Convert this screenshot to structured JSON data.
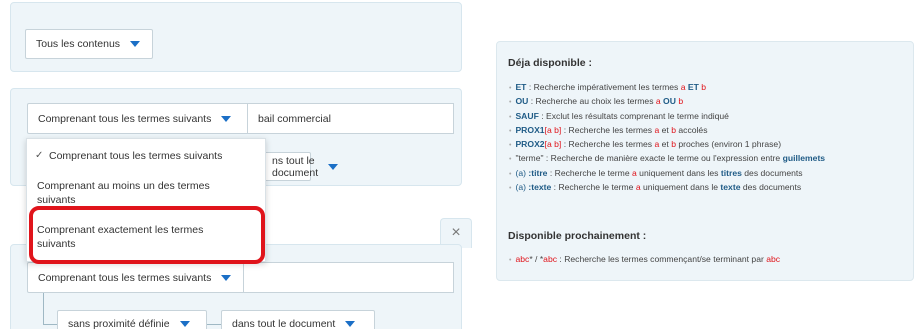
{
  "scope_select": {
    "value": "Tous les contenus"
  },
  "criterion1": {
    "mode_value": "Comprenant tous les termes suivants",
    "terms_value": "bail commercial",
    "location_partial": "ns tout le document"
  },
  "mode_dropdown": {
    "options": [
      {
        "label": "Comprenant tous les termes suivants",
        "selected": true
      },
      {
        "label_line1": "Comprenant au moins un des termes",
        "label_line2": "suivants",
        "selected": false
      },
      {
        "label_line1": "Comprenant exactement les termes",
        "label_line2": "suivants",
        "selected": false,
        "highlighted": true
      }
    ]
  },
  "close_icon": "×",
  "criterion2": {
    "mode_value": "Comprenant tous les termes suivants",
    "terms_value": "",
    "proximity_value": "sans proximité définie",
    "location_value": "dans tout le document"
  },
  "help": {
    "available_title": "Déja disponible :",
    "upcoming_title": "Disponible prochainement :",
    "items": [
      {
        "kw": "ET",
        "text": " : Recherche impérativement les termes ",
        "a": "a",
        "mid": " ",
        "kw2": "ET",
        "b": " b"
      },
      {
        "kw": "OU",
        "text": " : Recherche au choix les termes ",
        "a": "a",
        "mid": " ",
        "kw2": "OU",
        "b": " b"
      },
      {
        "kw": "SAUF",
        "text": " : Exclut les résultats comprenant le terme indiqué"
      },
      {
        "kw": "PROX1",
        "bracket": "[a b]",
        "text": " : Recherche les termes ",
        "a": "a",
        "mid": " et ",
        "b": "b",
        "tail": " accolés"
      },
      {
        "kw": "PROX2",
        "bracket": "[a b]",
        "text": " : Recherche les termes ",
        "a": "a",
        "mid": " et ",
        "b": "b",
        "tail": " proches (environ 1 phrase)"
      },
      {
        "plain": "\"terme\" : Recherche de manière exacte le terme ou l'expression entre ",
        "kw_end": "guillemets"
      },
      {
        "paren": "(a)",
        "kw": " :titre",
        "text": " : Recherche le terme ",
        "a": "a",
        "mid": " uniquement dans les ",
        "kw2": "titres",
        "tail": " des documents"
      },
      {
        "paren": "(a)",
        "kw": " :texte",
        "text": " : Recherche le terme ",
        "a": "a",
        "mid": " uniquement dans le ",
        "kw2": "texte",
        "tail": " des documents"
      }
    ],
    "upcoming": {
      "a1": "abc",
      "sep": "* / *",
      "a2": "abc",
      "text": " : Recherche les termes commençant/se terminant par ",
      "a3": "abc"
    }
  }
}
